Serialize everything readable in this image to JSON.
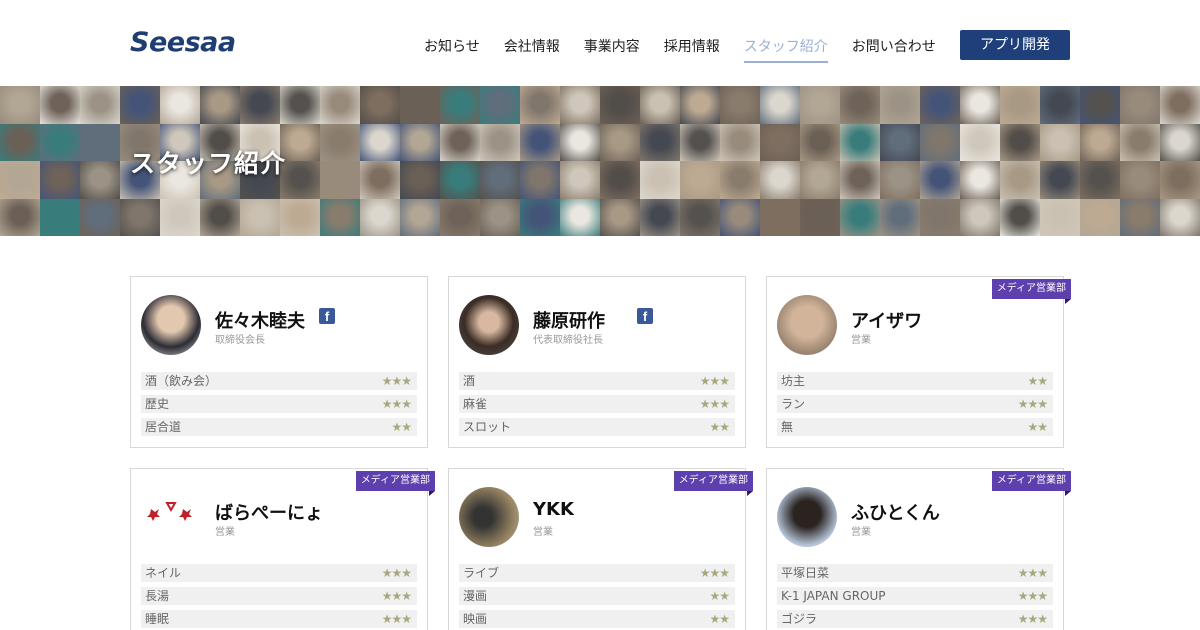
{
  "header": {
    "logo": "Seesaa",
    "nav": [
      "お知らせ",
      "会社情報",
      "事業内容",
      "採用情報",
      "スタッフ紹介",
      "お問い合わせ"
    ],
    "active_index": 4,
    "app_button": "アプリ開発",
    "colors": {
      "brand": "#1e3f7a",
      "active": "#9ab0d0",
      "logo_dot": "#d9263c"
    }
  },
  "hero": {
    "title": "スタッフ紹介"
  },
  "staff": [
    {
      "name": "佐々木睦夫",
      "role": "取締役会長",
      "facebook": true,
      "badge": "",
      "skills": [
        {
          "label": "酒（飲み会）",
          "stars": "★★★",
          "rating": 3
        },
        {
          "label": "歴史",
          "stars": "★★★",
          "rating": 3
        },
        {
          "label": "居合道",
          "stars": "★★",
          "rating": 2
        }
      ]
    },
    {
      "name": "藤原研作",
      "role": "代表取締役社長",
      "facebook": true,
      "badge": "",
      "skills": [
        {
          "label": "酒",
          "stars": "★★★",
          "rating": 3
        },
        {
          "label": "麻雀",
          "stars": "★★★",
          "rating": 3
        },
        {
          "label": "スロット",
          "stars": "★★",
          "rating": 2
        }
      ]
    },
    {
      "name": "アイザワ",
      "role": "営業",
      "facebook": false,
      "badge": "メディア営業部",
      "skills": [
        {
          "label": "坊主",
          "stars": "★★",
          "rating": 2
        },
        {
          "label": "ラン",
          "stars": "★★★",
          "rating": 3
        },
        {
          "label": "無",
          "stars": "★★",
          "rating": 2
        }
      ]
    },
    {
      "name": "ばらぺーにょ",
      "role": "営業",
      "facebook": false,
      "badge": "メディア営業部",
      "skills": [
        {
          "label": "ネイル",
          "stars": "★★★",
          "rating": 3
        },
        {
          "label": "長湯",
          "stars": "★★★",
          "rating": 3
        },
        {
          "label": "睡眠",
          "stars": "★★★",
          "rating": 3
        }
      ]
    },
    {
      "name": "YKK",
      "role": "営業",
      "facebook": false,
      "badge": "メディア営業部",
      "skills": [
        {
          "label": "ライブ",
          "stars": "★★★",
          "rating": 3
        },
        {
          "label": "漫画",
          "stars": "★★",
          "rating": 2
        },
        {
          "label": "映画",
          "stars": "★★",
          "rating": 2
        }
      ]
    },
    {
      "name": "ふひとくん",
      "role": "営業",
      "facebook": false,
      "badge": "メディア営業部",
      "skills": [
        {
          "label": "平塚日菜",
          "stars": "★★★",
          "rating": 3
        },
        {
          "label": "K-1 JAPAN GROUP",
          "stars": "★★★",
          "rating": 3
        },
        {
          "label": "ゴジラ",
          "stars": "★★★",
          "rating": 3
        }
      ]
    }
  ]
}
